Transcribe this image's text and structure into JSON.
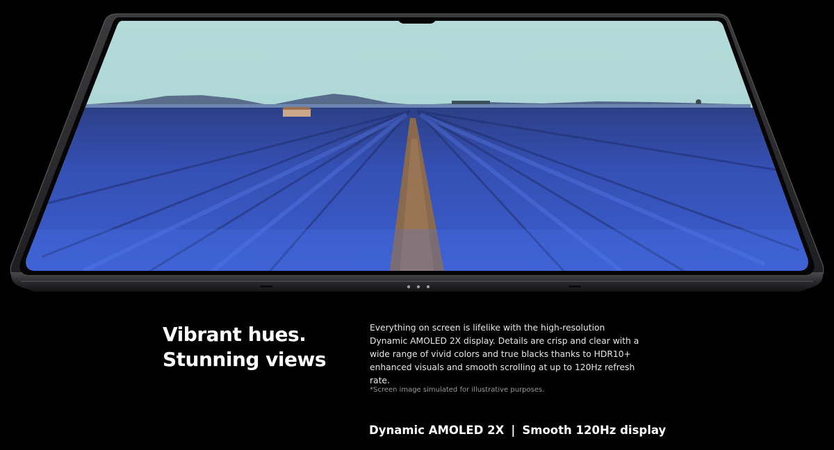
{
  "headline": {
    "line1": "Vibrant hues.",
    "line2": "Stunning views"
  },
  "body": {
    "text": "Everything on screen is lifelike with the high-resolution Dynamic AMOLED 2X display. Details are crisp and clear with a wide range of vivid colors and true blacks thanks to HDR10+ enhanced visuals and smooth scrolling at up to 120Hz refresh rate."
  },
  "disclaimer": {
    "text": "*Screen image simulated for illustrative purposes."
  },
  "features": {
    "item1": "Dynamic AMOLED 2X",
    "separator": "|",
    "item2": "Smooth 120Hz display"
  },
  "colors": {
    "background": "#000000",
    "sky": "#a9d6d8",
    "lavender": "#3b58c8",
    "frame": "#2b2b2e"
  },
  "device": {
    "image_subject": "lavender-field-on-tablet-screen"
  }
}
